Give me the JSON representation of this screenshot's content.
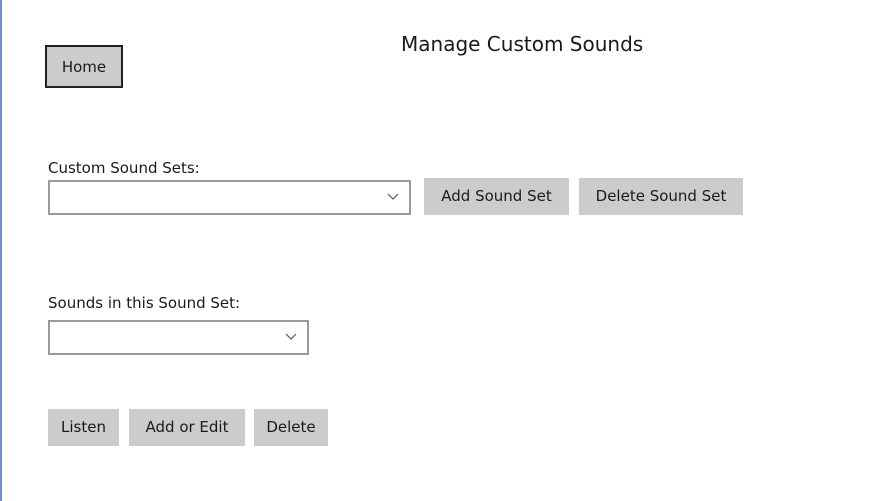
{
  "page": {
    "title": "Manage Custom Sounds",
    "home_label": "Home"
  },
  "sound_sets": {
    "label": "Custom Sound Sets:",
    "selected_value": "",
    "add_label": "Add Sound Set",
    "delete_label": "Delete Sound Set"
  },
  "sounds": {
    "label": "Sounds in this Sound Set:",
    "selected_value": "",
    "listen_label": "Listen",
    "add_edit_label": "Add or Edit",
    "delete_label": "Delete"
  },
  "icons": {
    "dropdown": "chevron-down-icon"
  },
  "colors": {
    "button_background": "#cccccc",
    "window_accent": "#6f8fd2",
    "combo_border": "#9a9a9a"
  }
}
